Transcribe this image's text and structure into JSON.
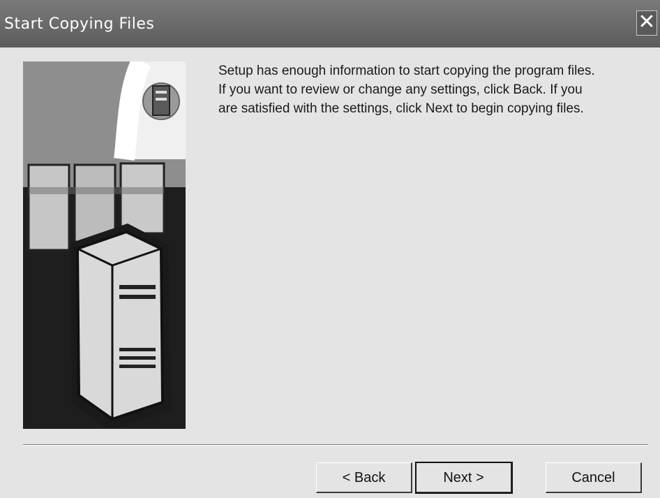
{
  "window": {
    "title": "Start Copying Files",
    "close_glyph": "✕"
  },
  "illustration": {
    "icon": "server-computers-illustration"
  },
  "message": {
    "line1": "Setup has enough information to start copying the program files.",
    "line2": "If you want to review or change any settings, click Back.  If you",
    "line3": "are satisfied with the settings, click Next to begin copying files."
  },
  "buttons": {
    "back": "< Back",
    "next": "Next >",
    "cancel": "Cancel"
  },
  "colors": {
    "titlebar": "#5c5c5c",
    "dialog_bg": "#e4e4e4"
  }
}
